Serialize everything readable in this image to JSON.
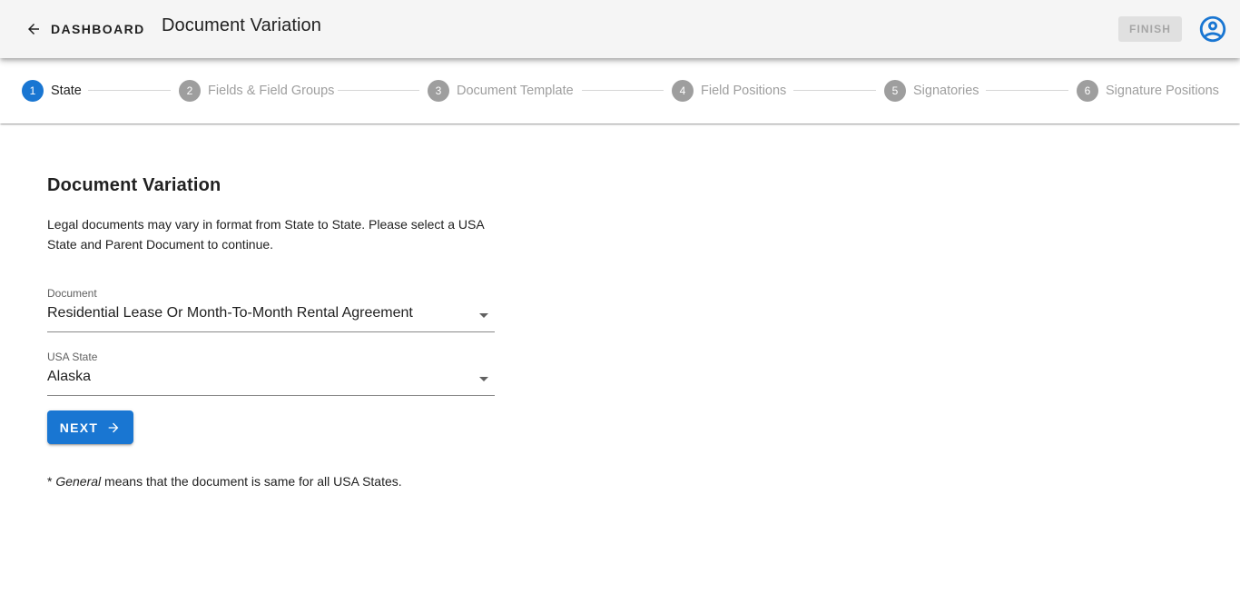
{
  "appbar": {
    "back_label": "DASHBOARD",
    "title": "Document Variation",
    "finish_label": "FINISH",
    "account_icon": "account-circle-icon"
  },
  "stepper": {
    "steps": [
      {
        "number": "1",
        "label": "State",
        "active": true
      },
      {
        "number": "2",
        "label": "Fields & Field Groups",
        "active": false
      },
      {
        "number": "3",
        "label": "Document Template",
        "active": false
      },
      {
        "number": "4",
        "label": "Field Positions",
        "active": false
      },
      {
        "number": "5",
        "label": "Signatories",
        "active": false
      },
      {
        "number": "6",
        "label": "Signature Positions",
        "active": false
      }
    ]
  },
  "main": {
    "heading": "Document Variation",
    "description": "Legal documents may vary in format from State to State. Please select a USA State and Parent Document to continue.",
    "document_field": {
      "label": "Document",
      "value": "Residential Lease Or Month-To-Month Rental Agreement"
    },
    "state_field": {
      "label": "USA State",
      "value": "Alaska"
    },
    "next_label": "NEXT",
    "footnote_prefix": "* ",
    "footnote_em": "General",
    "footnote_rest": " means that the document is same for all USA States."
  },
  "colors": {
    "primary": "#1976d2",
    "appbar_bg": "#f5f5f5",
    "inactive_step": "#9e9e9e",
    "disabled_button_bg": "#e0e0e0"
  }
}
